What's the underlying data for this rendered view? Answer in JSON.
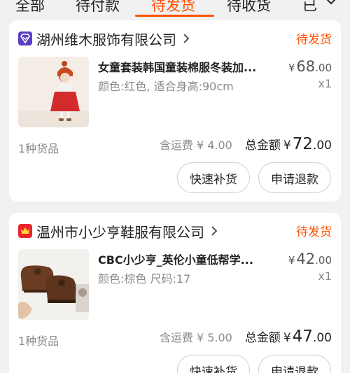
{
  "tabs": [
    {
      "label": "全部"
    },
    {
      "label": "待付款"
    },
    {
      "label": "待发货"
    },
    {
      "label": "待收货"
    },
    {
      "label": "已"
    }
  ],
  "colors": {
    "accent": "#ff5000",
    "shop1_icon": "#5b3fc4",
    "shop2_icon": "#e8242d"
  },
  "orders": [
    {
      "shop_name": "湖州维木服饰有限公司",
      "shop_icon": "shop-badge-icon",
      "status": "待发货",
      "product_title": "女童套装韩国童装棉服冬装加...",
      "sku": "颜色:红色, 适合身高:90cm",
      "price_currency": "¥",
      "price_int": "68",
      "price_dec": ".00",
      "quantity": "x1",
      "item_count": "1种货品",
      "shipping": "含运费 ¥ 4.00",
      "total_label": "总金额",
      "total_currency": "¥",
      "total_int": "72",
      "total_dec": ".00",
      "btn_restock": "快速补货",
      "btn_refund": "申请退款"
    },
    {
      "shop_name": "温州市小少亨鞋服有限公司",
      "shop_icon": "crown-icon",
      "status": "待发货",
      "product_title": "CBC小少亨_英伦小童低帮学...",
      "sku": "颜色:棕色 尺码:17",
      "price_currency": "¥",
      "price_int": "42",
      "price_dec": ".00",
      "quantity": "x1",
      "item_count": "1种货品",
      "shipping": "含运费 ¥ 5.00",
      "total_label": "总金额",
      "total_currency": "¥",
      "total_int": "47",
      "total_dec": ".00",
      "btn_restock": "快速补货",
      "btn_refund": "申请退款"
    }
  ]
}
